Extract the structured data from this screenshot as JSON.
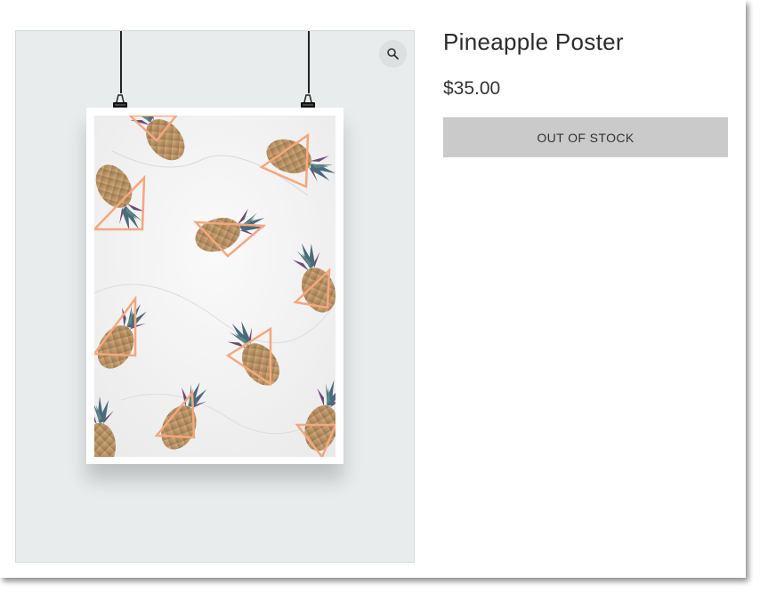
{
  "product": {
    "title": "Pineapple Poster",
    "price": "$35.00",
    "stock_button_label": "OUT OF STOCK"
  },
  "gallery": {
    "zoom_icon": "magnifier-icon",
    "background_color": "#e8ecec"
  },
  "colors": {
    "triangle_accent": "#f4a77e",
    "button_bg": "#cacaca",
    "title_text": "#2b2b2b"
  }
}
